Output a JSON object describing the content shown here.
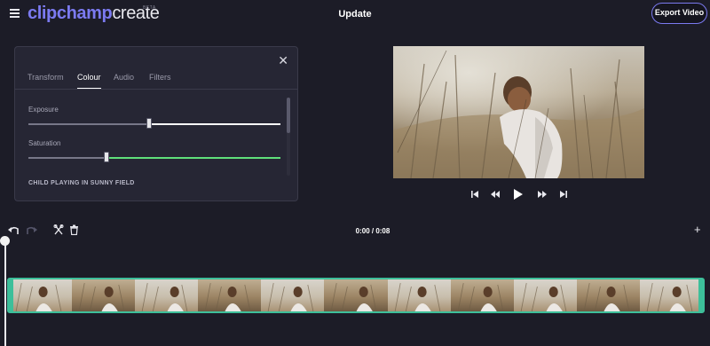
{
  "app": {
    "logo_primary": "clipchamp",
    "logo_secondary": "create",
    "logo_badge": "BETA",
    "title": "Update",
    "export_label": "Export Video"
  },
  "panel": {
    "tabs": [
      {
        "label": "Transform",
        "active": false
      },
      {
        "label": "Colour",
        "active": true
      },
      {
        "label": "Audio",
        "active": false
      },
      {
        "label": "Filters",
        "active": false
      }
    ],
    "sliders": [
      {
        "label": "Exposure",
        "value": 0.48,
        "fill_color": "#ffffff"
      },
      {
        "label": "Saturation",
        "value": 0.31,
        "fill_color": "#5fe07a"
      }
    ],
    "clip_name": "CHILD PLAYING IN SUNNY FIELD",
    "close_icon": "close-icon"
  },
  "player": {
    "controls": [
      "skip-to-start-icon",
      "rewind-icon",
      "play-icon",
      "fast-forward-icon",
      "skip-to-end-icon"
    ]
  },
  "toolbar": {
    "timecode": "0:00 / 0:08",
    "tools": [
      "undo-icon",
      "redo-icon",
      "split-icon",
      "delete-icon"
    ],
    "add_label": "+"
  },
  "timeline": {
    "frame_count": 11,
    "clip_color": "#3dbf9a"
  },
  "colors": {
    "accent": "#7b7af0",
    "background": "#1c1c27",
    "panel": "#262634",
    "saturation_fill": "#5fe07a"
  }
}
